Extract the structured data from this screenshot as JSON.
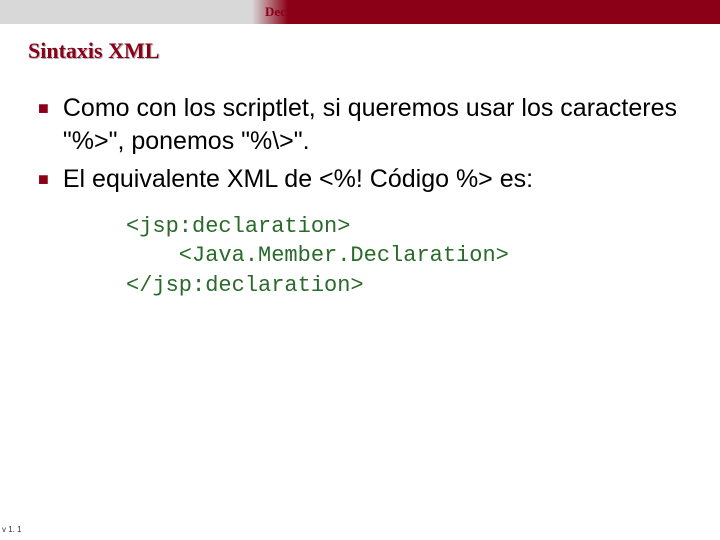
{
  "header": {
    "title": "Declaraciones"
  },
  "subtitle": "Sintaxis XML",
  "bullets": [
    {
      "text": "Como con los scriptlet, si queremos usar los caracteres \"%>\", ponemos \"%\\>\"."
    },
    {
      "text": "El equivalente XML de <%! Código %> es:"
    }
  ],
  "code": {
    "line1": "<jsp:declaration>",
    "line2": "    <Java.Member.Declaration>",
    "line3": "</jsp:declaration>"
  },
  "footer": {
    "version": "v 1. 1"
  }
}
